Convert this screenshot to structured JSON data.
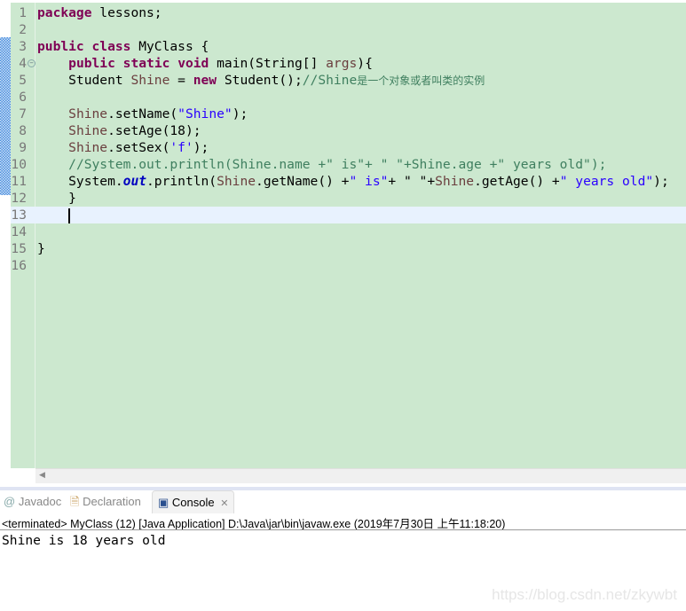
{
  "editor": {
    "current_line": 13,
    "lines": [
      {
        "n": "1",
        "tokens": [
          {
            "t": "package",
            "c": "kw"
          },
          {
            "t": " lessons;",
            "c": ""
          }
        ]
      },
      {
        "n": "2",
        "tokens": []
      },
      {
        "n": "3",
        "tokens": [
          {
            "t": "public",
            "c": "kw"
          },
          {
            "t": " ",
            "c": ""
          },
          {
            "t": "class",
            "c": "kw"
          },
          {
            "t": " MyClass {",
            "c": ""
          }
        ]
      },
      {
        "n": "4",
        "fold": true,
        "tokens": [
          {
            "t": "    ",
            "c": ""
          },
          {
            "t": "public",
            "c": "kw"
          },
          {
            "t": " ",
            "c": ""
          },
          {
            "t": "static",
            "c": "kw"
          },
          {
            "t": " ",
            "c": ""
          },
          {
            "t": "void",
            "c": "kw"
          },
          {
            "t": " main(String[] ",
            "c": ""
          },
          {
            "t": "args",
            "c": "var"
          },
          {
            "t": "){",
            "c": ""
          }
        ]
      },
      {
        "n": "5",
        "tokens": [
          {
            "t": "    Student ",
            "c": ""
          },
          {
            "t": "Shine",
            "c": "var"
          },
          {
            "t": " = ",
            "c": ""
          },
          {
            "t": "new",
            "c": "kw"
          },
          {
            "t": " Student();",
            "c": ""
          },
          {
            "t": "//Shine",
            "c": "cmt"
          },
          {
            "t": "是一个对象或者叫类的实例",
            "c": "cmt cjk"
          }
        ]
      },
      {
        "n": "6",
        "tokens": []
      },
      {
        "n": "7",
        "tokens": [
          {
            "t": "    ",
            "c": ""
          },
          {
            "t": "Shine",
            "c": "var"
          },
          {
            "t": ".setName(",
            "c": ""
          },
          {
            "t": "\"Shine\"",
            "c": "str"
          },
          {
            "t": ");",
            "c": ""
          }
        ]
      },
      {
        "n": "8",
        "tokens": [
          {
            "t": "    ",
            "c": ""
          },
          {
            "t": "Shine",
            "c": "var"
          },
          {
            "t": ".setAge(18);",
            "c": ""
          }
        ]
      },
      {
        "n": "9",
        "tokens": [
          {
            "t": "    ",
            "c": ""
          },
          {
            "t": "Shine",
            "c": "var"
          },
          {
            "t": ".setSex(",
            "c": ""
          },
          {
            "t": "'f'",
            "c": "str"
          },
          {
            "t": ");",
            "c": ""
          }
        ]
      },
      {
        "n": "10",
        "tokens": [
          {
            "t": "    ",
            "c": ""
          },
          {
            "t": "//System.out.println(Shine.name +\" is\"+ \" \"+Shine.age +\" years old\");",
            "c": "cmt"
          }
        ]
      },
      {
        "n": "11",
        "tokens": [
          {
            "t": "    System.",
            "c": ""
          },
          {
            "t": "out",
            "c": "fld"
          },
          {
            "t": ".println(",
            "c": ""
          },
          {
            "t": "Shine",
            "c": "var"
          },
          {
            "t": ".getName() +",
            "c": ""
          },
          {
            "t": "\" is\"",
            "c": "str"
          },
          {
            "t": "+ \" \"+",
            "c": ""
          },
          {
            "t": "Shine",
            "c": "var"
          },
          {
            "t": ".getAge() +",
            "c": ""
          },
          {
            "t": "\" years old\"",
            "c": "str"
          },
          {
            "t": ");",
            "c": ""
          }
        ]
      },
      {
        "n": "12",
        "tokens": [
          {
            "t": "    }",
            "c": ""
          }
        ]
      },
      {
        "n": "13",
        "caret": true,
        "tokens": [
          {
            "t": "    ",
            "c": ""
          }
        ]
      },
      {
        "n": "14",
        "tokens": []
      },
      {
        "n": "15",
        "tokens": [
          {
            "t": "}",
            "c": ""
          }
        ]
      },
      {
        "n": "16",
        "tokens": []
      }
    ]
  },
  "panel": {
    "tabs": [
      {
        "label": "Javadoc",
        "icon": "at-icon",
        "active": false
      },
      {
        "label": "Declaration",
        "icon": "declaration-icon",
        "active": false
      },
      {
        "label": "Console",
        "icon": "console-icon",
        "active": true
      }
    ],
    "close_glyph": "✕",
    "status": "<terminated> MyClass (12) [Java Application] D:\\Java\\jar\\bin\\javaw.exe (2019年7月30日 上午11:18:20)",
    "output": "Shine is 18 years old"
  },
  "watermark": "https://blog.csdn.net/zkywbt"
}
